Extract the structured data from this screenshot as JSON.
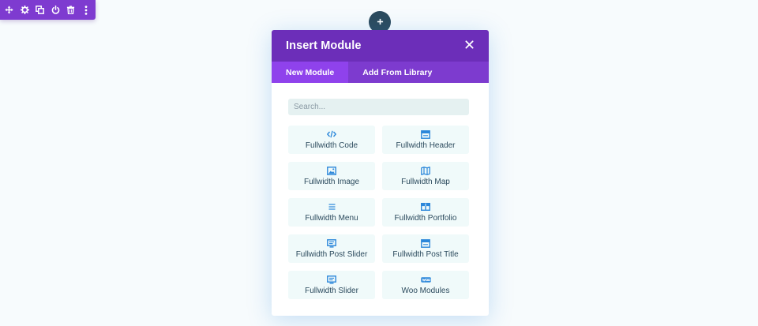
{
  "row_toolbar": {
    "icons": [
      "move-icon",
      "settings-icon",
      "duplicate-icon",
      "power-icon",
      "trash-icon",
      "more-icon"
    ]
  },
  "add_button": {
    "icon": "plus-icon"
  },
  "modal": {
    "title": "Insert Module",
    "close_icon": "close-icon",
    "tabs": [
      {
        "label": "New Module",
        "active": true
      },
      {
        "label": "Add From Library",
        "active": false
      }
    ],
    "search": {
      "placeholder": "Search...",
      "value": ""
    },
    "modules": [
      {
        "label": "Fullwidth Code",
        "icon": "code-icon"
      },
      {
        "label": "Fullwidth Header",
        "icon": "header-icon"
      },
      {
        "label": "Fullwidth Image",
        "icon": "image-icon"
      },
      {
        "label": "Fullwidth Map",
        "icon": "map-icon"
      },
      {
        "label": "Fullwidth Menu",
        "icon": "menu-icon"
      },
      {
        "label": "Fullwidth Portfolio",
        "icon": "portfolio-icon"
      },
      {
        "label": "Fullwidth Post Slider",
        "icon": "post-slider-icon"
      },
      {
        "label": "Fullwidth Post Title",
        "icon": "post-title-icon"
      },
      {
        "label": "Fullwidth Slider",
        "icon": "slider-icon"
      },
      {
        "label": "Woo Modules",
        "icon": "woo-icon"
      }
    ]
  },
  "colors": {
    "page_background": "#f7fbfd",
    "toolbar_purple": "#7e3bd0",
    "modal_header": "#6c2eb9",
    "tab_bar": "#7d3bcf",
    "tab_active": "#8f42ec",
    "module_background": "#f0fafa",
    "module_icon": "#2b87da",
    "module_text": "#2b4a5d"
  }
}
